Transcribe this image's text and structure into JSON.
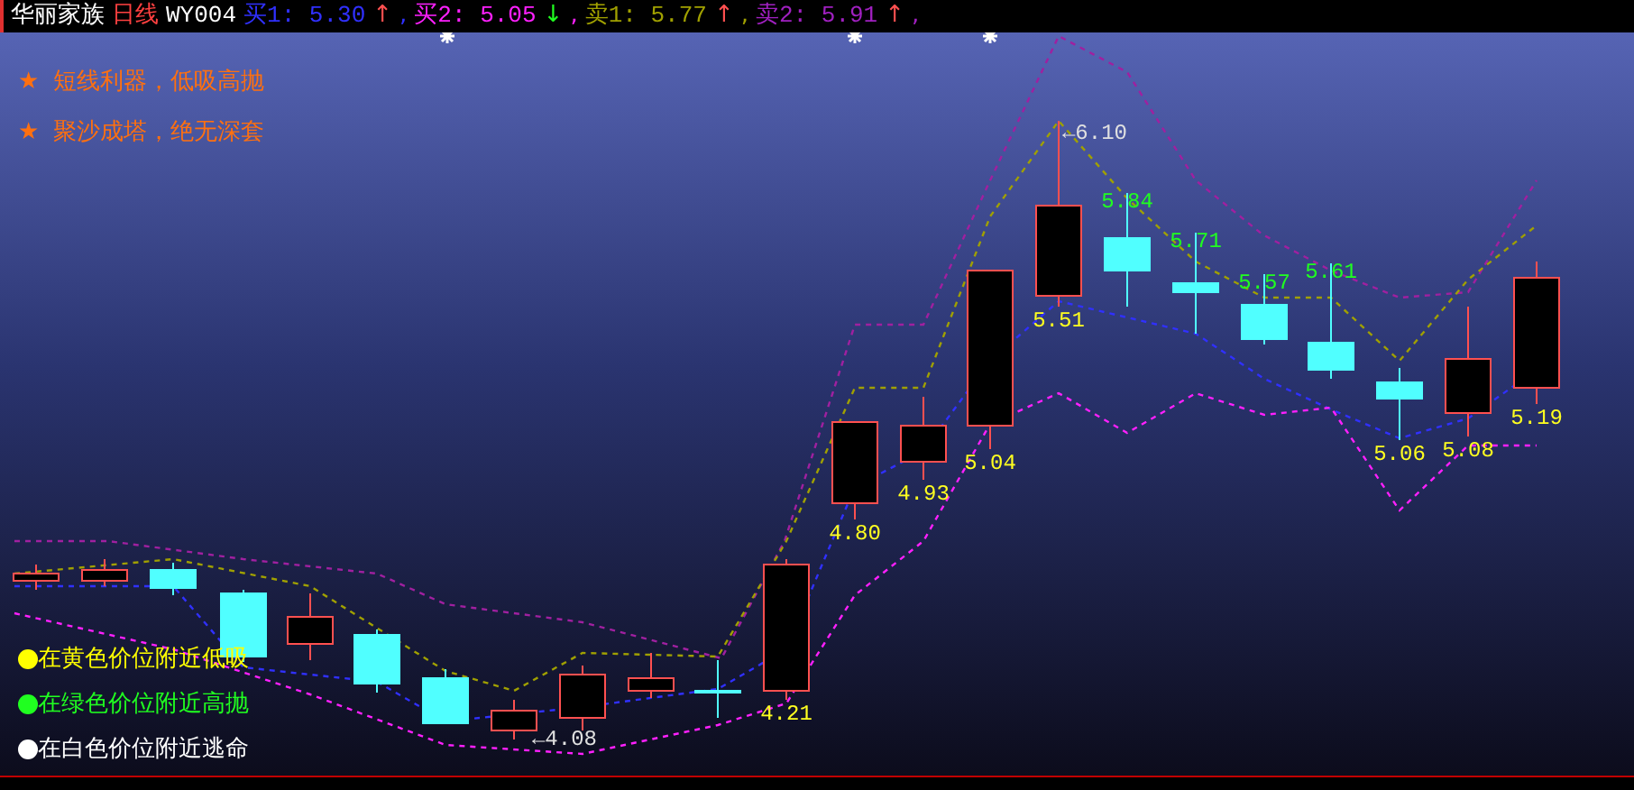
{
  "header": {
    "stock": "华丽家族",
    "period": "日线",
    "indicator": "WY004",
    "signals": [
      {
        "label": "买1: 5.30",
        "arrow": {
          "text": "↑",
          "color": "#ff5050"
        },
        "color": "#3030ff"
      },
      {
        "label": "买2: 5.05",
        "arrow": {
          "text": "↓",
          "color": "#20ff20"
        },
        "color": "#ff20ff"
      },
      {
        "label": "卖1: 5.77",
        "arrow": {
          "text": "↑",
          "color": "#ff5050"
        },
        "color": "#a0a000"
      },
      {
        "label": "卖2: 5.91",
        "arrow": {
          "text": "↑",
          "color": "#ff5050"
        },
        "color": "#a020c0"
      }
    ],
    "separator": ","
  },
  "notes": [
    {
      "star": "★",
      "text": "短线利器，低吸高抛"
    },
    {
      "star": "★",
      "text": "聚沙成塔，绝无深套"
    }
  ],
  "candles": [
    {
      "kind": "up"
    },
    {
      "kind": "up"
    },
    {
      "kind": "down"
    },
    {
      "kind": "down"
    },
    {
      "kind": "up"
    },
    {
      "kind": "down"
    },
    {
      "kind": "down"
    },
    {
      "label": {
        "text": "←4.08",
        "color": "#e0e0e0"
      },
      "kind": "up"
    },
    {
      "kind": "up"
    },
    {
      "kind": "up"
    },
    {
      "kind": "down"
    },
    {
      "label": {
        "text": "4.21",
        "color": "#ffff20"
      },
      "kind": "up"
    },
    {
      "label": {
        "text": "4.80",
        "color": "#ffff20"
      },
      "kind": "up"
    },
    {
      "label": {
        "text": "4.93",
        "color": "#ffff20"
      },
      "kind": "up"
    },
    {
      "label": {
        "text": "5.04",
        "color": "#ffff20"
      },
      "kind": "up"
    },
    {
      "label": {
        "text": "5.51",
        "color": "#ffff20"
      },
      "kind": "up",
      "extra": "←6.10"
    },
    {
      "label": {
        "text": "5.84",
        "color": "#20ff20"
      },
      "kind": "down"
    },
    {
      "label": {
        "text": "5.71",
        "color": "#20ff20"
      },
      "kind": "down"
    },
    {
      "label": {
        "text": "5.57",
        "color": "#20ff20"
      },
      "kind": "down"
    },
    {
      "label": {
        "text": "5.61",
        "color": "#20ff20"
      },
      "kind": "down"
    },
    {
      "label": {
        "text": "5.06",
        "color": "#ffff20"
      },
      "kind": "down"
    },
    {
      "label": {
        "text": "5.08",
        "color": "#ffff20"
      },
      "kind": "up"
    },
    {
      "label": {
        "text": "5.19",
        "color": "#ffff20"
      },
      "kind": "up"
    }
  ],
  "legend": [
    {
      "text": "在黄色价位附近低吸",
      "color": "#ffff00"
    },
    {
      "text": "在绿色价位附近高抛",
      "color": "#20ff20"
    },
    {
      "text": "在白色价位附近逃命",
      "color": "#ffffff"
    }
  ]
}
